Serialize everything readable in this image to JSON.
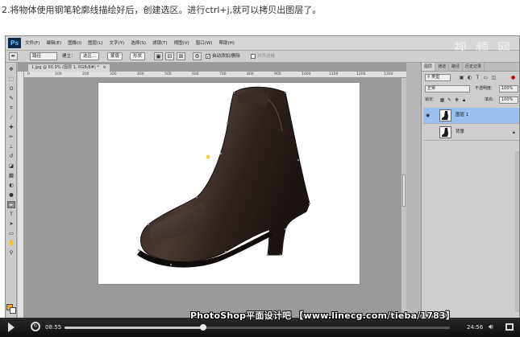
{
  "caption": "2.将物体使用钢笔轮廓线描绘好后，创建选区。进行ctrl+j,就可以拷贝出图层了。",
  "app": {
    "logo": "Ps",
    "watermark": "视 频 网",
    "menu": [
      "文件(F)",
      "编辑(E)",
      "图像(I)",
      "图层(L)",
      "文字(Y)",
      "选择(S)",
      "滤镜(T)",
      "视图(V)",
      "窗口(W)",
      "帮助(H)"
    ]
  },
  "options_bar": {
    "mode": "路径",
    "build_label": "建立：",
    "selection_btn": "选区...",
    "mask_btn": "蒙版",
    "shape_btn": "形状",
    "auto_add_delete": "自动添加/删除",
    "align_edges": "对齐边缘"
  },
  "document": {
    "tab_title": "1.jpg @ 60.9% (图层 1, RGB/8#) *",
    "tab_close": "×",
    "ruler_ticks": [
      "0",
      "100",
      "200",
      "300",
      "400",
      "500",
      "600",
      "700",
      "800",
      "900",
      "1000",
      "1100",
      "1200",
      "1300"
    ]
  },
  "layers_panel": {
    "tabs": [
      "图层",
      "通道",
      "路径",
      "历史记录"
    ],
    "filter_kind": "类型",
    "blend_mode": "正常",
    "opacity_label": "不透明度:",
    "opacity_value": "100%",
    "lock_label": "锁定:",
    "fill_label": "填充:",
    "fill_value": "100%",
    "layers": [
      {
        "name": "图层 1",
        "selected": true,
        "visible": true,
        "locked": false
      },
      {
        "name": "背景",
        "selected": false,
        "visible": false,
        "locked": true
      }
    ]
  },
  "video": {
    "current_time": "08:55",
    "total_time": "24:56",
    "progress": 0.36,
    "overlay_title": "PhotoShop平面设计吧 【www.linecg.com/tieba/1783】"
  },
  "colors": {
    "foreground": "#f5a623",
    "background": "#ffffff",
    "selected_layer": "#9cc0ee"
  }
}
